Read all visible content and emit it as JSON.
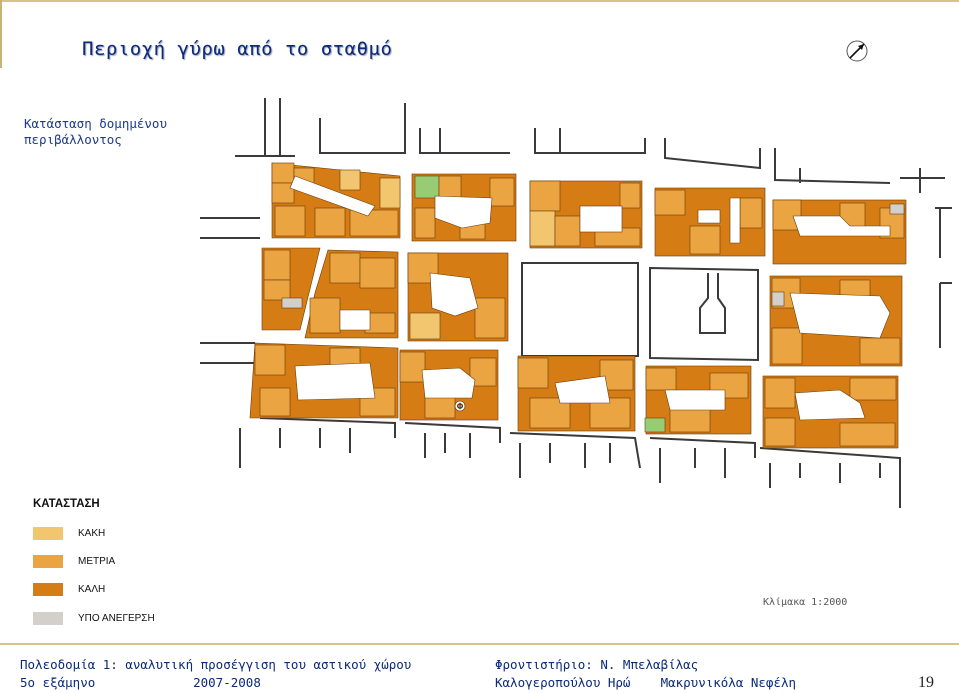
{
  "title": "Περιοχή γύρω από το σταθμό",
  "subtitle_line1": "Κατάσταση δομημένου",
  "subtitle_line2": "περιβάλλοντος",
  "legend": {
    "title": "ΚΑΤΑΣΤΑΣΗ",
    "items": [
      {
        "label": "ΚΑΚΗ",
        "color": "#f2c66f"
      },
      {
        "label": "ΜΕΤΡΙΑ",
        "color": "#eaa441"
      },
      {
        "label": "ΚΑΛΗ",
        "color": "#d57c14"
      },
      {
        "label": "ΥΠΟ ΑΝΕΓΕΡΣΗ",
        "color": "#d3d0cb"
      }
    ]
  },
  "other_colors": {
    "green_space": "#98cc74",
    "street_outline": "#3a3a3a"
  },
  "map_symbol": "Φ",
  "scale": "Κλίμακα 1:2000",
  "footer": {
    "course": "Πολεοδομία 1: αναλυτική προσέγγιση του αστικού χώρου",
    "semester": "5ο εξάμηνο",
    "year": "2007-2008",
    "tutorial": "Φροντιστήριο: Ν. Μπελαβίλας",
    "authors": "Καλογεροπούλου Ηρώ    Μακρυνικόλα Νεφέλη"
  },
  "page_number": "19"
}
